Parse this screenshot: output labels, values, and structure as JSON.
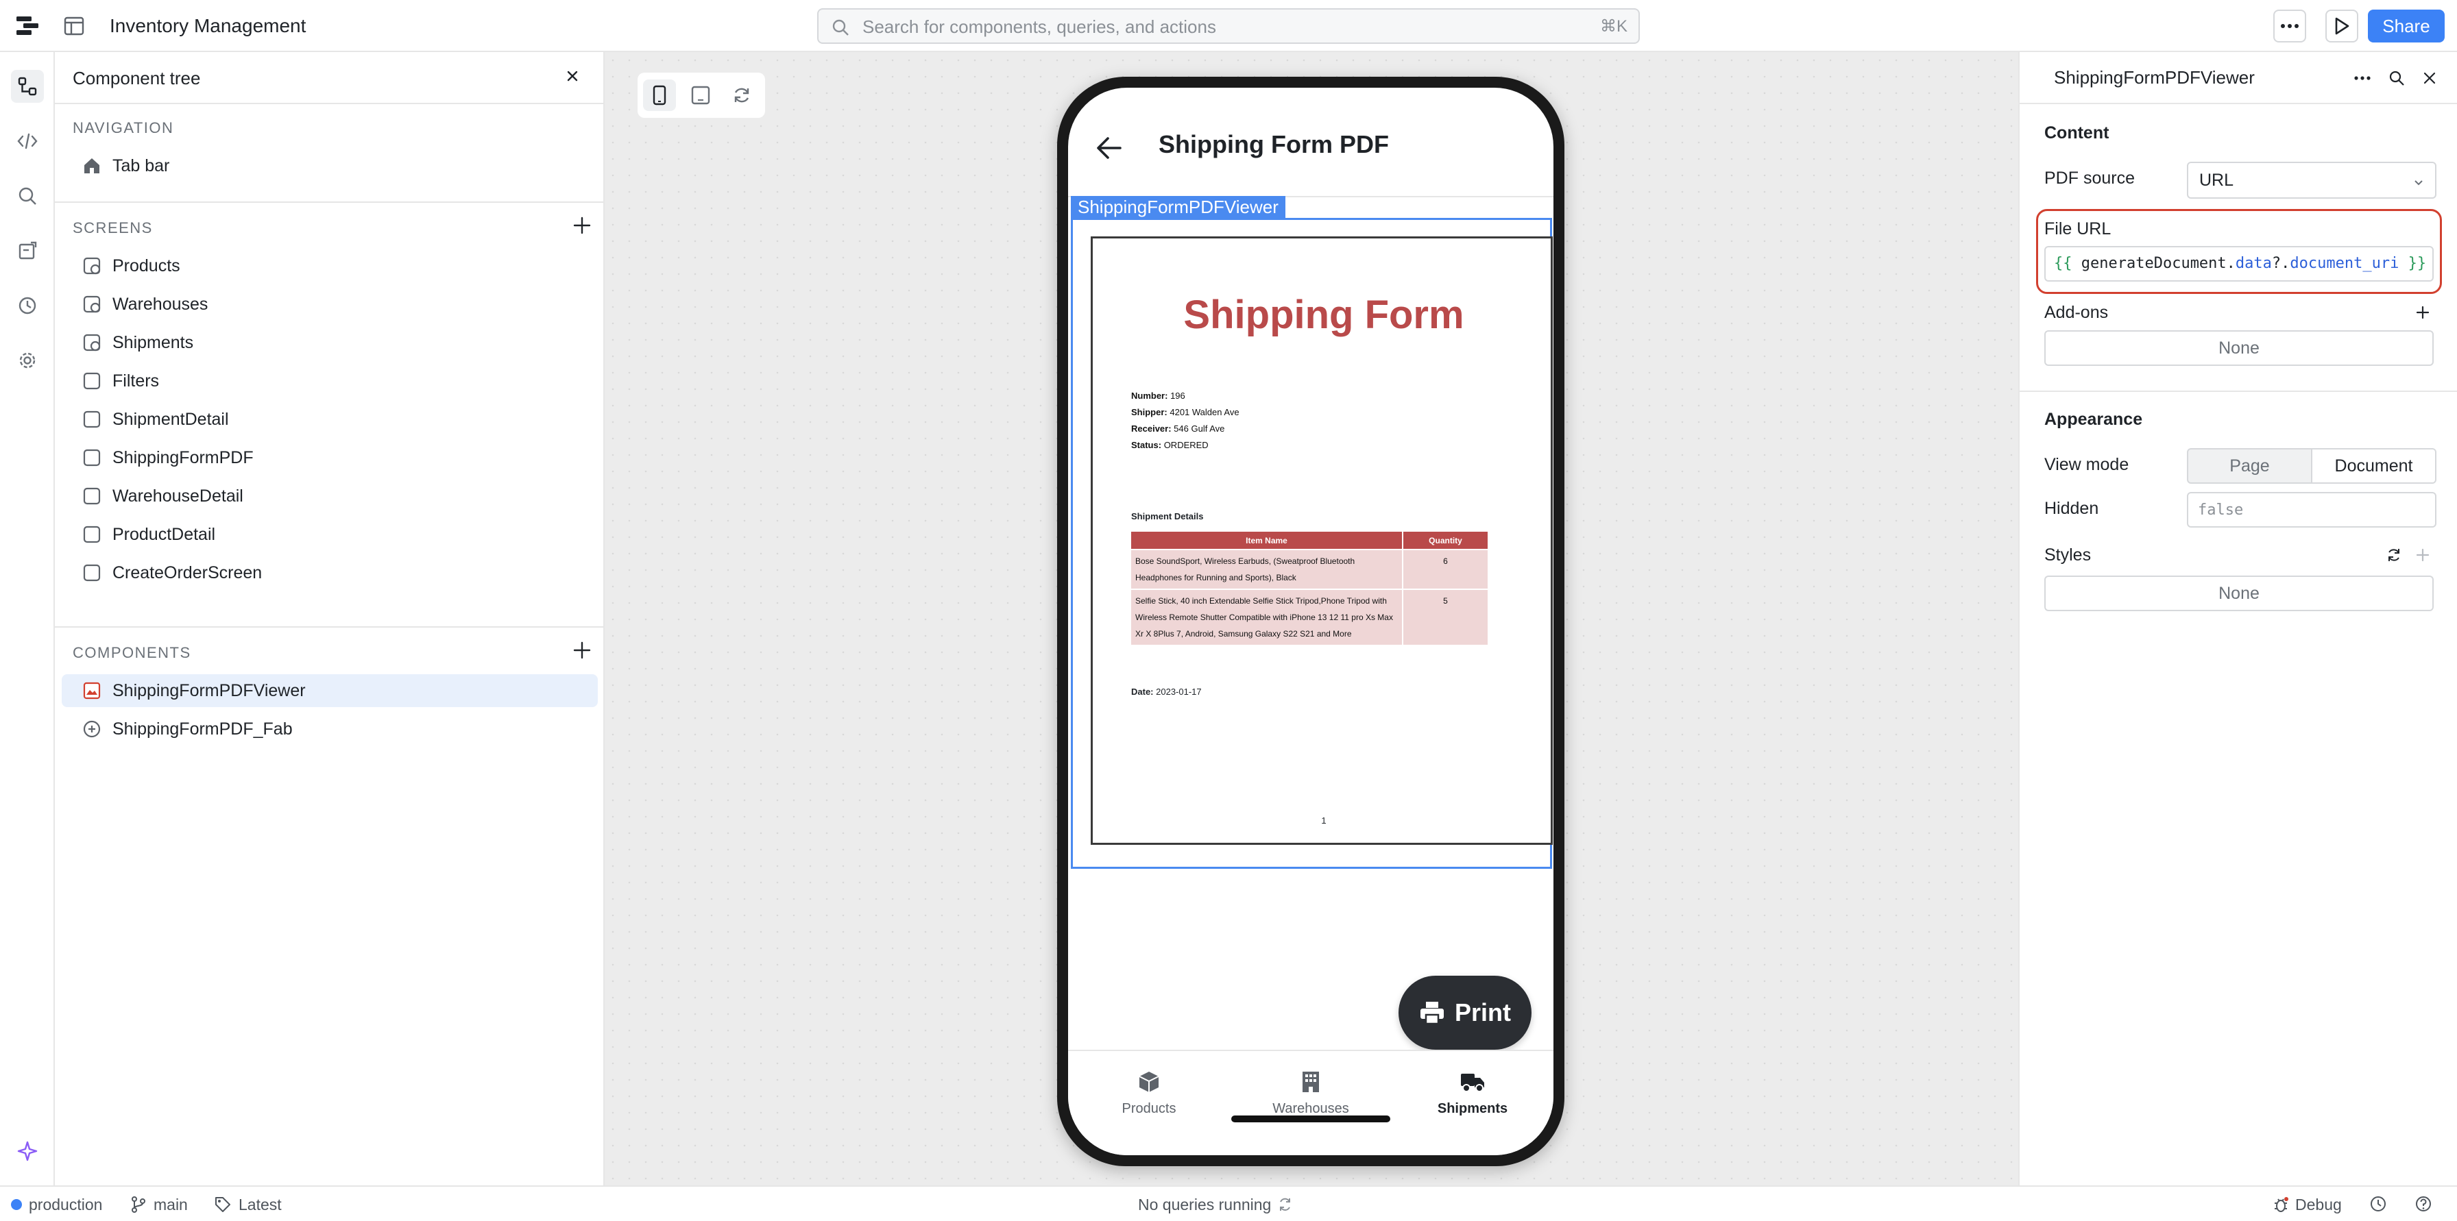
{
  "app": {
    "title": "Inventory Management"
  },
  "search": {
    "placeholder": "Search for components, queries, and actions",
    "shortcut": "⌘K"
  },
  "toolbar": {
    "share_label": "Share"
  },
  "tree": {
    "title": "Component tree",
    "navigation_label": "NAVIGATION",
    "navigation_items": [
      {
        "label": "Tab bar",
        "icon": "home-icon"
      }
    ],
    "screens_label": "SCREENS",
    "screens": [
      {
        "label": "Products",
        "icon": "screen-tab-icon"
      },
      {
        "label": "Warehouses",
        "icon": "screen-tab-icon"
      },
      {
        "label": "Shipments",
        "icon": "screen-tab-icon"
      },
      {
        "label": "Filters",
        "icon": "screen-icon"
      },
      {
        "label": "ShipmentDetail",
        "icon": "screen-icon"
      },
      {
        "label": "ShippingFormPDF",
        "icon": "screen-icon"
      },
      {
        "label": "WarehouseDetail",
        "icon": "screen-icon"
      },
      {
        "label": "ProductDetail",
        "icon": "screen-icon"
      },
      {
        "label": "CreateOrderScreen",
        "icon": "screen-icon"
      }
    ],
    "components_label": "COMPONENTS",
    "components": [
      {
        "label": "ShippingFormPDFViewer",
        "icon": "pdf-icon",
        "selected": true
      },
      {
        "label": "ShippingFormPDF_Fab",
        "icon": "fab-icon",
        "selected": false
      }
    ]
  },
  "preview": {
    "screen_title": "Shipping Form PDF",
    "component_tag": "ShippingFormPDFViewer",
    "pdf": {
      "title": "Shipping Form",
      "meta": [
        {
          "label": "Number:",
          "value": "196"
        },
        {
          "label": "Shipper:",
          "value": "4201 Walden Ave"
        },
        {
          "label": "Receiver:",
          "value": "546 Gulf Ave"
        },
        {
          "label": "Status:",
          "value": "ORDERED"
        }
      ],
      "details_heading": "Shipment Details",
      "columns": [
        "Item Name",
        "Quantity"
      ],
      "rows": [
        {
          "item": "Bose SoundSport, Wireless Earbuds, (Sweatproof Bluetooth Headphones for Running and Sports), Black",
          "qty": "6"
        },
        {
          "item": "Selfie Stick, 40 inch Extendable Selfie Stick Tripod,Phone Tripod with Wireless Remote Shutter Compatible with iPhone 13 12 11 pro Xs Max Xr X 8Plus 7, Android, Samsung Galaxy S22 S21 and More",
          "qty": "5"
        }
      ],
      "date_label": "Date:",
      "date_value": "2023-01-17",
      "page_number": "1"
    },
    "fab_label": "Print",
    "tabs": [
      {
        "label": "Products",
        "icon": "box-icon",
        "active": false
      },
      {
        "label": "Warehouses",
        "icon": "building-icon",
        "active": false
      },
      {
        "label": "Shipments",
        "icon": "truck-icon",
        "active": true
      }
    ]
  },
  "inspector": {
    "title": "ShippingFormPDFViewer",
    "content_label": "Content",
    "pdf_source_label": "PDF source",
    "pdf_source_value": "URL",
    "file_url_label": "File URL",
    "file_url_tokens": {
      "open": "{{",
      "object": "generateDocument",
      "dot1": ".",
      "prop1": "data",
      "sep": "?.",
      "prop2": "document_uri",
      "close": "}}"
    },
    "addons_label": "Add-ons",
    "addons_value": "None",
    "appearance_label": "Appearance",
    "view_mode_label": "View mode",
    "view_mode_options": [
      "Page",
      "Document"
    ],
    "view_mode_selected": "Document",
    "hidden_label": "Hidden",
    "hidden_value": "false",
    "styles_label": "Styles",
    "styles_value": "None"
  },
  "status": {
    "environment": "production",
    "branch": "main",
    "version": "Latest",
    "queries": "No queries running",
    "debug": "Debug"
  },
  "colors": {
    "accent": "#3c82f6",
    "highlight_border": "#d2402f",
    "pdf_red": "#b94a4a"
  }
}
